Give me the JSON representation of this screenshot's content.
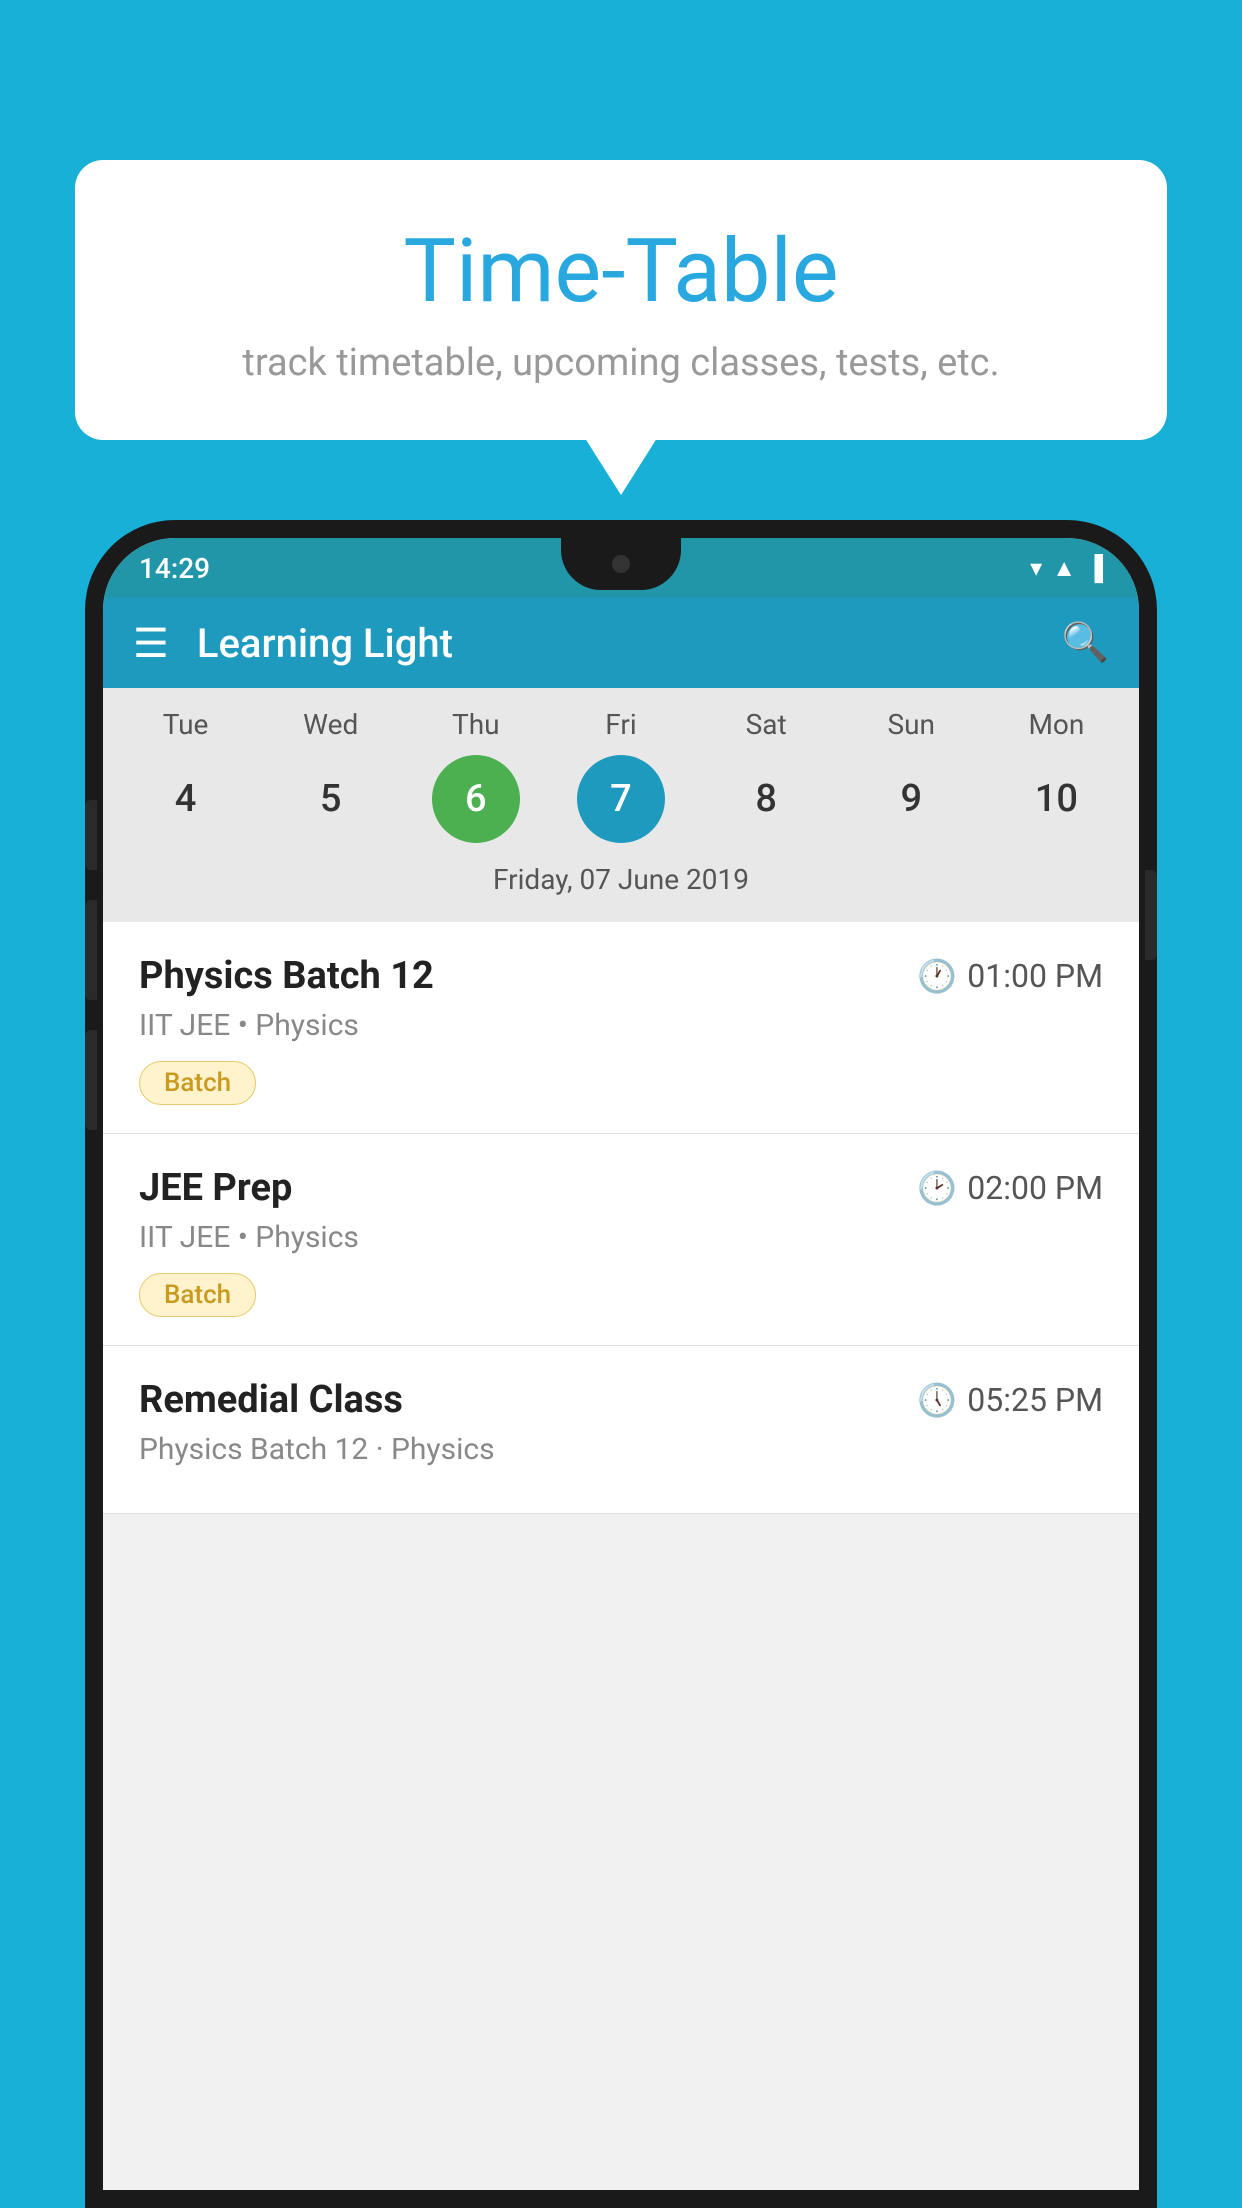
{
  "background_color": "#19b0d8",
  "bubble": {
    "title": "Time-Table",
    "subtitle": "track timetable, upcoming classes, tests, etc."
  },
  "phone": {
    "status_bar": {
      "time": "14:29"
    },
    "app_bar": {
      "title": "Learning Light"
    },
    "calendar": {
      "days": [
        {
          "label": "Tue",
          "num": "4",
          "state": "normal"
        },
        {
          "label": "Wed",
          "num": "5",
          "state": "normal"
        },
        {
          "label": "Thu",
          "num": "6",
          "state": "today"
        },
        {
          "label": "Fri",
          "num": "7",
          "state": "selected"
        },
        {
          "label": "Sat",
          "num": "8",
          "state": "normal"
        },
        {
          "label": "Sun",
          "num": "9",
          "state": "normal"
        },
        {
          "label": "Mon",
          "num": "10",
          "state": "normal"
        }
      ],
      "selected_date_label": "Friday, 07 June 2019"
    },
    "schedule": [
      {
        "title": "Physics Batch 12",
        "time": "01:00 PM",
        "subtitle": "IIT JEE • Physics",
        "badge": "Batch"
      },
      {
        "title": "JEE Prep",
        "time": "02:00 PM",
        "subtitle": "IIT JEE • Physics",
        "badge": "Batch"
      },
      {
        "title": "Remedial Class",
        "time": "05:25 PM",
        "subtitle": "Physics Batch 12 · Physics",
        "badge": null
      }
    ]
  }
}
